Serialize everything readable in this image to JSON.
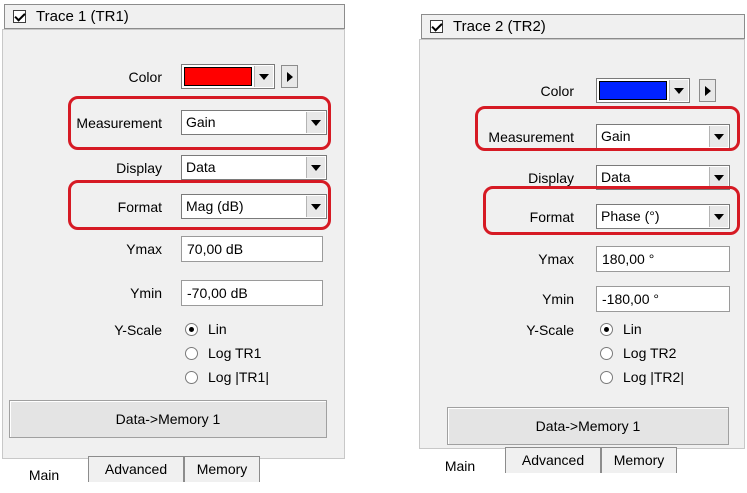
{
  "trace1": {
    "enabled": true,
    "title": "Trace 1 (TR1)",
    "color": {
      "label": "Color",
      "value_hex": "#ff0000"
    },
    "measurement": {
      "label": "Measurement",
      "value": "Gain"
    },
    "display": {
      "label": "Display",
      "value": "Data"
    },
    "format": {
      "label": "Format",
      "value": "Mag (dB)"
    },
    "ymax": {
      "label": "Ymax",
      "value": "70,00 dB"
    },
    "ymin": {
      "label": "Ymin",
      "value": "-70,00 dB"
    },
    "yscale": {
      "label": "Y-Scale",
      "options": [
        "Lin",
        "Log TR1",
        "Log |TR1|"
      ],
      "selected": "Lin"
    },
    "memory_button": "Data->Memory 1",
    "tabs": [
      "Main",
      "Advanced",
      "Memory"
    ],
    "active_tab": "Main"
  },
  "trace2": {
    "enabled": true,
    "title": "Trace 2 (TR2)",
    "color": {
      "label": "Color",
      "value_hex": "#0022ff"
    },
    "measurement": {
      "label": "Measurement",
      "value": "Gain"
    },
    "display": {
      "label": "Display",
      "value": "Data"
    },
    "format": {
      "label": "Format",
      "value": "Phase (°)"
    },
    "ymax": {
      "label": "Ymax",
      "value": "180,00 °"
    },
    "ymin": {
      "label": "Ymin",
      "value": "-180,00 °"
    },
    "yscale": {
      "label": "Y-Scale",
      "options": [
        "Lin",
        "Log TR2",
        "Log |TR2|"
      ],
      "selected": "Lin"
    },
    "memory_button": "Data->Memory 1",
    "tabs": [
      "Main",
      "Advanced",
      "Memory"
    ],
    "active_tab": "Main"
  },
  "highlight_color": "#d61a24"
}
